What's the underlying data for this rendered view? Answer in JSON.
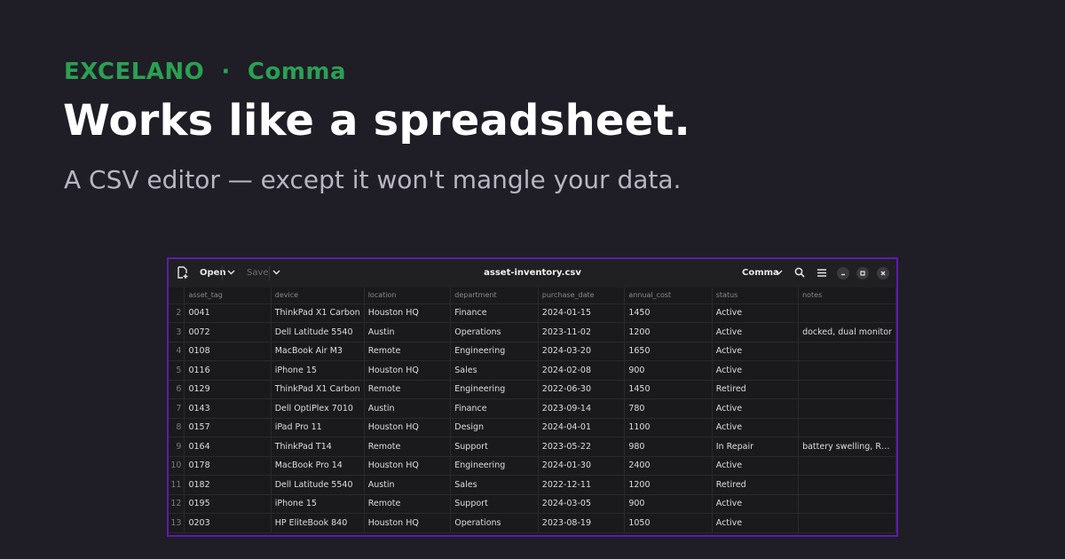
{
  "brand": {
    "name": "EXCELANO",
    "separator": "·",
    "product": "Comma",
    "color": "#2aa052"
  },
  "headline": "Works like a spreadsheet.",
  "subline": "A CSV editor — except it won't mangle your data.",
  "app": {
    "border_color": "#5b1cb0",
    "toolbar": {
      "open_label": "Open",
      "save_label": "Save",
      "title": "asset-inventory.csv",
      "delimiter_label": "Comma"
    },
    "columns": [
      "asset_tag",
      "device",
      "location",
      "department",
      "purchase_date",
      "annual_cost",
      "status",
      "notes"
    ],
    "rows": [
      {
        "num": "2",
        "cells": [
          "0041",
          "ThinkPad X1 Carbon",
          "Houston HQ",
          "Finance",
          "2024-01-15",
          "1450",
          "Active",
          ""
        ]
      },
      {
        "num": "3",
        "cells": [
          "0072",
          "Dell Latitude 5540",
          "Austin",
          "Operations",
          "2023-11-02",
          "1200",
          "Active",
          "docked, dual monitor"
        ]
      },
      {
        "num": "4",
        "cells": [
          "0108",
          "MacBook Air M3",
          "Remote",
          "Engineering",
          "2024-03-20",
          "1650",
          "Active",
          ""
        ]
      },
      {
        "num": "5",
        "cells": [
          "0116",
          "iPhone 15",
          "Houston HQ",
          "Sales",
          "2024-02-08",
          "900",
          "Active",
          ""
        ]
      },
      {
        "num": "6",
        "cells": [
          "0129",
          "ThinkPad X1 Carbon",
          "Remote",
          "Engineering",
          "2022-06-30",
          "1450",
          "Retired",
          ""
        ]
      },
      {
        "num": "7",
        "cells": [
          "0143",
          "Dell OptiPlex 7010",
          "Austin",
          "Finance",
          "2023-09-14",
          "780",
          "Active",
          ""
        ]
      },
      {
        "num": "8",
        "cells": [
          "0157",
          "iPad Pro 11",
          "Houston HQ",
          "Design",
          "2024-04-01",
          "1100",
          "Active",
          ""
        ]
      },
      {
        "num": "9",
        "cells": [
          "0164",
          "ThinkPad T14",
          "Remote",
          "Support",
          "2023-05-22",
          "980",
          "In Repair",
          "battery swelling, R…"
        ]
      },
      {
        "num": "10",
        "cells": [
          "0178",
          "MacBook Pro 14",
          "Houston HQ",
          "Engineering",
          "2024-01-30",
          "2400",
          "Active",
          ""
        ]
      },
      {
        "num": "11",
        "cells": [
          "0182",
          "Dell Latitude 5540",
          "Austin",
          "Sales",
          "2022-12-11",
          "1200",
          "Retired",
          ""
        ]
      },
      {
        "num": "12",
        "cells": [
          "0195",
          "iPhone 15",
          "Remote",
          "Support",
          "2024-03-05",
          "900",
          "Active",
          ""
        ]
      },
      {
        "num": "13",
        "cells": [
          "0203",
          "HP EliteBook 840",
          "Houston HQ",
          "Operations",
          "2023-08-19",
          "1050",
          "Active",
          ""
        ]
      }
    ]
  }
}
